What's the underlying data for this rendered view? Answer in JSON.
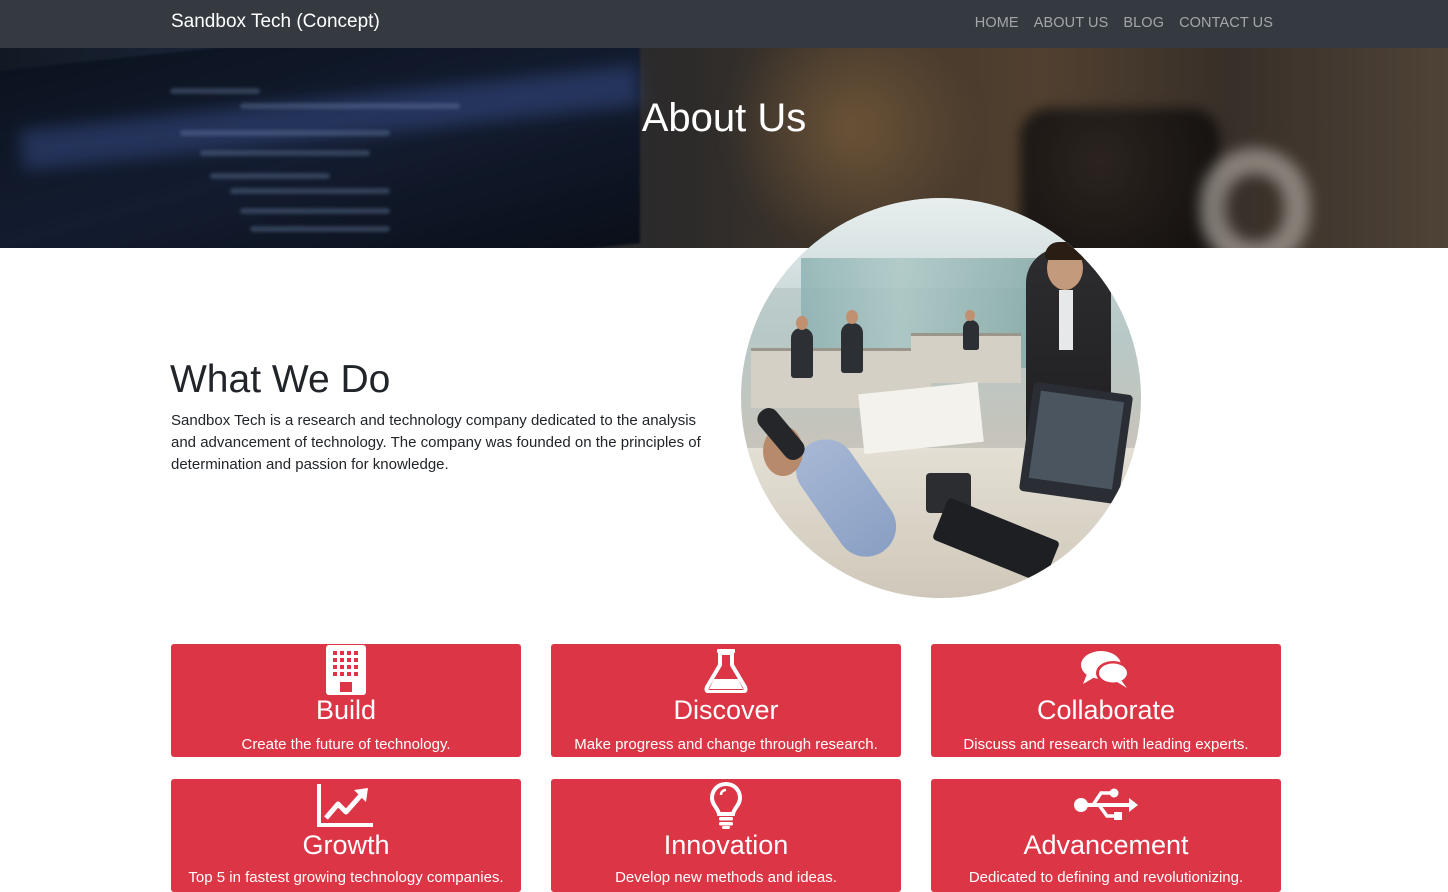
{
  "navbar": {
    "brand": "Sandbox Tech (Concept)",
    "links": [
      "HOME",
      "ABOUT US",
      "BLOG",
      "CONTACT US"
    ]
  },
  "hero": {
    "title": "About Us"
  },
  "about": {
    "heading": "What We Do",
    "text": "Sandbox Tech is a research and technology company dedicated to the analysis and advancement of technology. The company was founded on the principles of determination and passion for knowledge."
  },
  "features": [
    {
      "icon": "building-icon",
      "title": "Build",
      "text": "Create the future of technology."
    },
    {
      "icon": "flask-icon",
      "title": "Discover",
      "text": "Make progress and change through research."
    },
    {
      "icon": "comments-icon",
      "title": "Collaborate",
      "text": "Discuss and research with leading experts."
    },
    {
      "icon": "line-chart-icon",
      "title": "Growth",
      "text": "Top 5 in fastest growing technology companies."
    },
    {
      "icon": "lightbulb-icon",
      "title": "Innovation",
      "text": "Develop new methods and ideas."
    },
    {
      "icon": "usb-icon",
      "title": "Advancement",
      "text": "Dedicated to defining and revolutionizing."
    }
  ],
  "colors": {
    "navbar": "#343a40",
    "card": "#dc3545",
    "text": "#212529"
  }
}
